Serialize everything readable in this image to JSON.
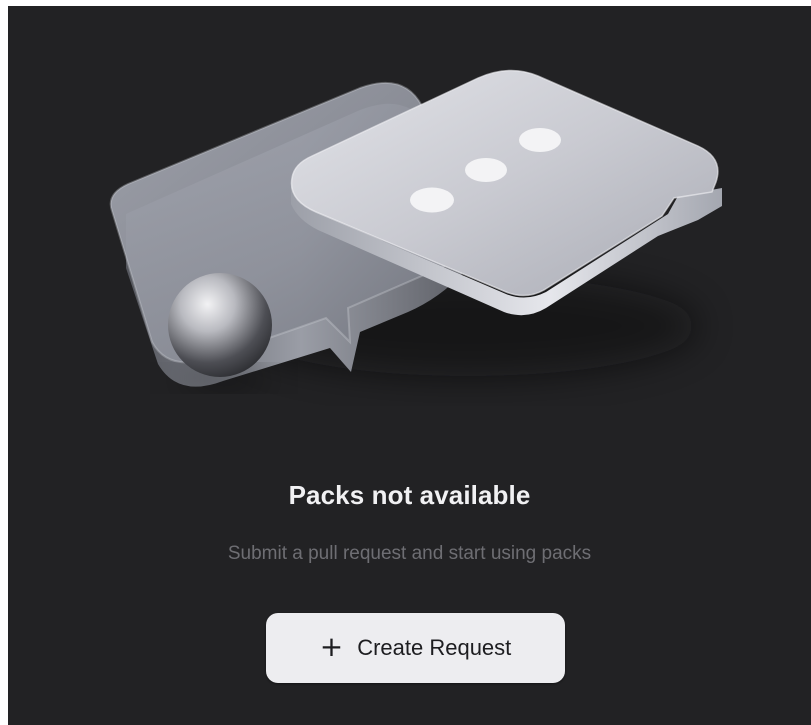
{
  "empty_state": {
    "title": "Packs not available",
    "subtitle": "Submit a pull request and start using packs",
    "illustration_icon": "chat-bubbles-illustration-icon"
  },
  "actions": {
    "create_request": {
      "icon": "plus-icon",
      "plus_glyph": "+",
      "label": "Create Request"
    }
  },
  "colors": {
    "background": "#222224",
    "title": "#f1f1f3",
    "subtitle": "#6e6e73",
    "button_background": "#ededf0",
    "button_text": "#1d1d20"
  }
}
